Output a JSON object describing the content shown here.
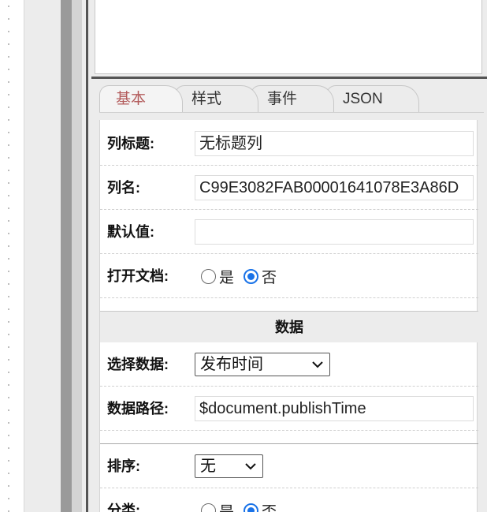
{
  "tabs": [
    {
      "label": "基本",
      "active": true
    },
    {
      "label": "样式",
      "active": false
    },
    {
      "label": "事件",
      "active": false
    },
    {
      "label": "JSON",
      "active": false
    }
  ],
  "basic": {
    "column_title": {
      "label": "列标题:",
      "value": "无标题列"
    },
    "column_name": {
      "label": "列名:",
      "value": "C99E3082FAB00001641078E3A86D"
    },
    "default_value": {
      "label": "默认值:",
      "value": ""
    },
    "open_doc": {
      "label": "打开文档:",
      "options": [
        "是",
        "否"
      ],
      "selected": "否"
    }
  },
  "data_section": {
    "title": "数据",
    "select_data": {
      "label": "选择数据:",
      "value": "发布时间"
    },
    "data_path": {
      "label": "数据路径:",
      "value": "$document.publishTime"
    }
  },
  "sort": {
    "label": "排序:",
    "value": "无"
  },
  "category": {
    "label": "分类:",
    "options": [
      "是",
      "否"
    ],
    "selected": "否"
  },
  "colors": {
    "active_tab": "#b35c5c",
    "radio_accent": "#1a73e8",
    "panel_bg": "#ececec"
  }
}
